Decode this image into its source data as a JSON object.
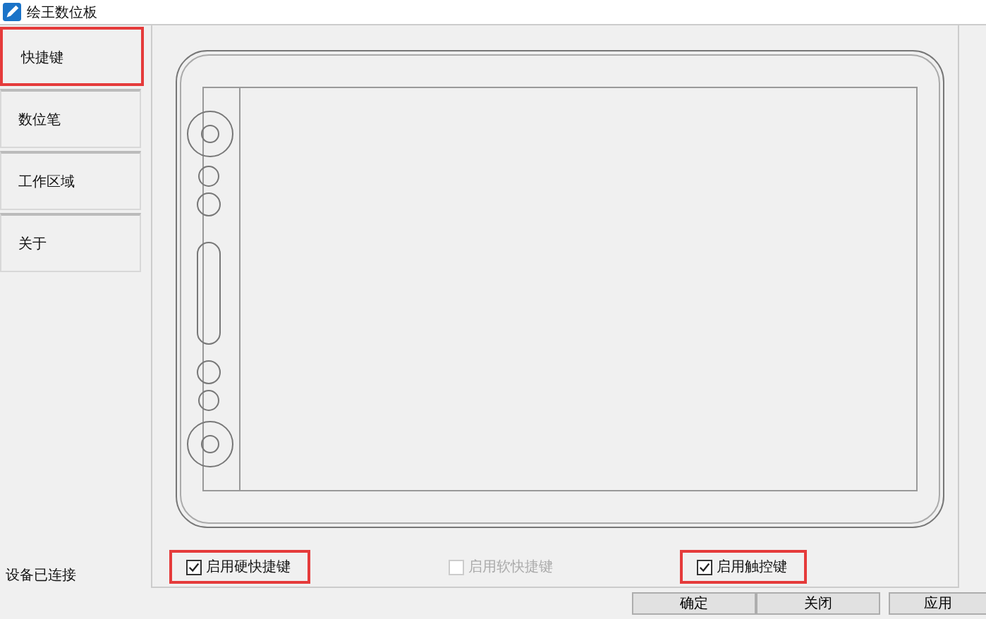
{
  "window": {
    "title": "绘王数位板"
  },
  "sidebar": {
    "items": [
      {
        "label": "快捷键",
        "selected": true,
        "highlighted": true
      },
      {
        "label": "数位笔",
        "selected": false,
        "highlighted": false
      },
      {
        "label": "工作区域",
        "selected": false,
        "highlighted": false
      },
      {
        "label": "关于",
        "selected": false,
        "highlighted": false
      }
    ]
  },
  "status": "设备已连接",
  "options": [
    {
      "label": "启用硬快捷键",
      "checked": true,
      "disabled": false,
      "highlighted": true
    },
    {
      "label": "启用软快捷键",
      "checked": false,
      "disabled": true,
      "highlighted": false
    },
    {
      "label": "启用触控键",
      "checked": true,
      "disabled": false,
      "highlighted": true
    }
  ],
  "buttons": [
    "确定",
    "关闭",
    "应用"
  ]
}
